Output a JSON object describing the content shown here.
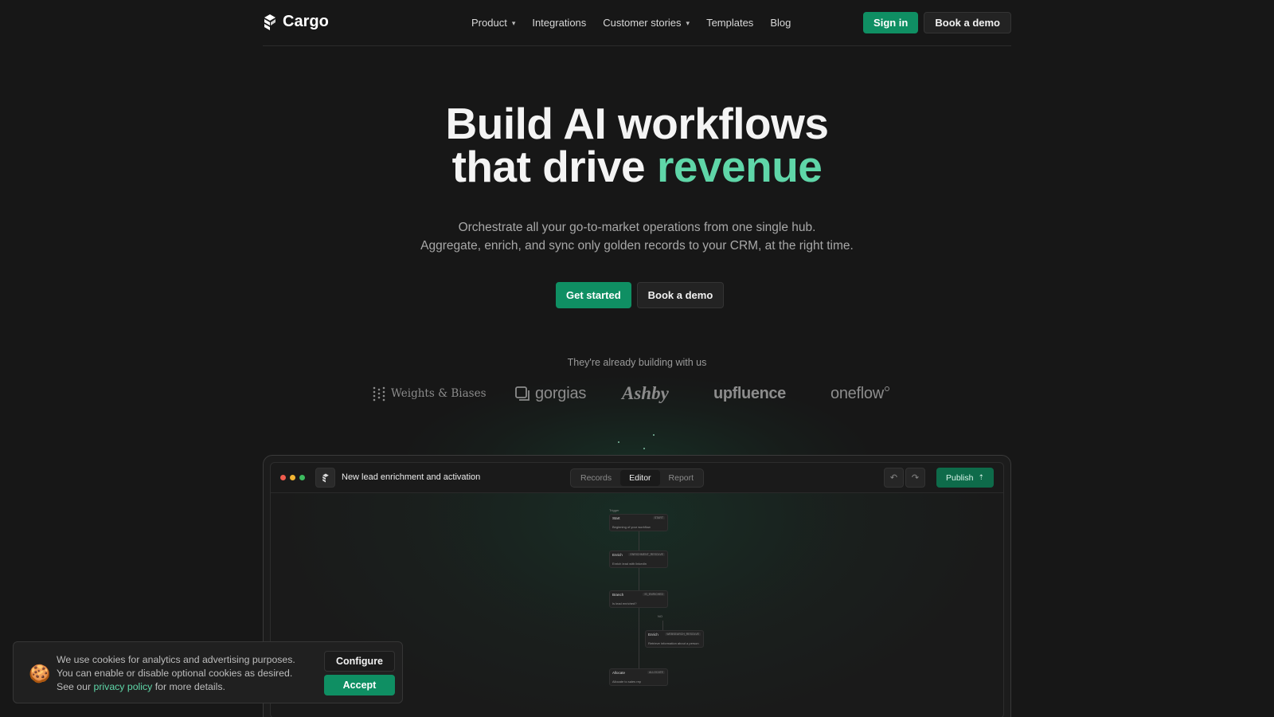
{
  "brand": {
    "name": "Cargo"
  },
  "nav": {
    "links": [
      {
        "label": "Product",
        "dropdown": true
      },
      {
        "label": "Integrations",
        "dropdown": false
      },
      {
        "label": "Customer stories",
        "dropdown": true
      },
      {
        "label": "Templates",
        "dropdown": false
      },
      {
        "label": "Blog",
        "dropdown": false
      }
    ],
    "sign_in": "Sign in",
    "book_demo": "Book a demo"
  },
  "hero": {
    "title_line1": "Build AI workflows",
    "title_line2_prefix": "that drive ",
    "title_line2_accent": "revenue",
    "subtitle_line1": "Orchestrate all your go-to-market operations from one single hub.",
    "subtitle_line2": "Aggregate, enrich, and sync only golden records to your CRM, at the right time.",
    "cta_primary": "Get started",
    "cta_secondary": "Book a demo"
  },
  "trust": {
    "heading": "They're already building with us",
    "logos": [
      "Weights & Biases",
      "gorgias",
      "Ashby",
      "upfluence",
      "oneflow"
    ]
  },
  "app": {
    "workflow_title": "New lead enrichment and activation",
    "tabs": [
      "Records",
      "Editor",
      "Report"
    ],
    "active_tab": "Editor",
    "publish_label": "Publish",
    "trigger_label": "Trigger",
    "nodes": [
      {
        "title": "Start",
        "tag": "START",
        "desc": "Beginning of your workflow"
      },
      {
        "title": "Enrich",
        "tag": "ENRICHMENT_RESOLVE",
        "desc": "Enrich lead with linkedin"
      },
      {
        "title": "Branch",
        "tag": "IS_ENRICHED",
        "desc": "Is lead enriched?"
      },
      {
        "title": "Enrich",
        "tag": "WEBSEARCH_RESOLVE",
        "desc": "Retrieve information about a person"
      },
      {
        "title": "Allocate",
        "tag": "ALLOCATE",
        "desc": "Allocate to sales rep"
      }
    ],
    "branch_no": "NO",
    "colors": {
      "dot_red": "#ef5b4d",
      "dot_yellow": "#f2b533",
      "dot_green": "#3dbc5f"
    }
  },
  "cookie": {
    "text_line1": "We use cookies for analytics and advertising purposes.",
    "text_line2": "You can enable or disable optional cookies as desired.",
    "text_prefix": "See our ",
    "link": "privacy policy",
    "text_suffix": " for more details.",
    "configure": "Configure",
    "accept": "Accept"
  },
  "colors": {
    "accent": "#5fd6a8",
    "primary_button": "#0f8f63",
    "background": "#171717"
  }
}
